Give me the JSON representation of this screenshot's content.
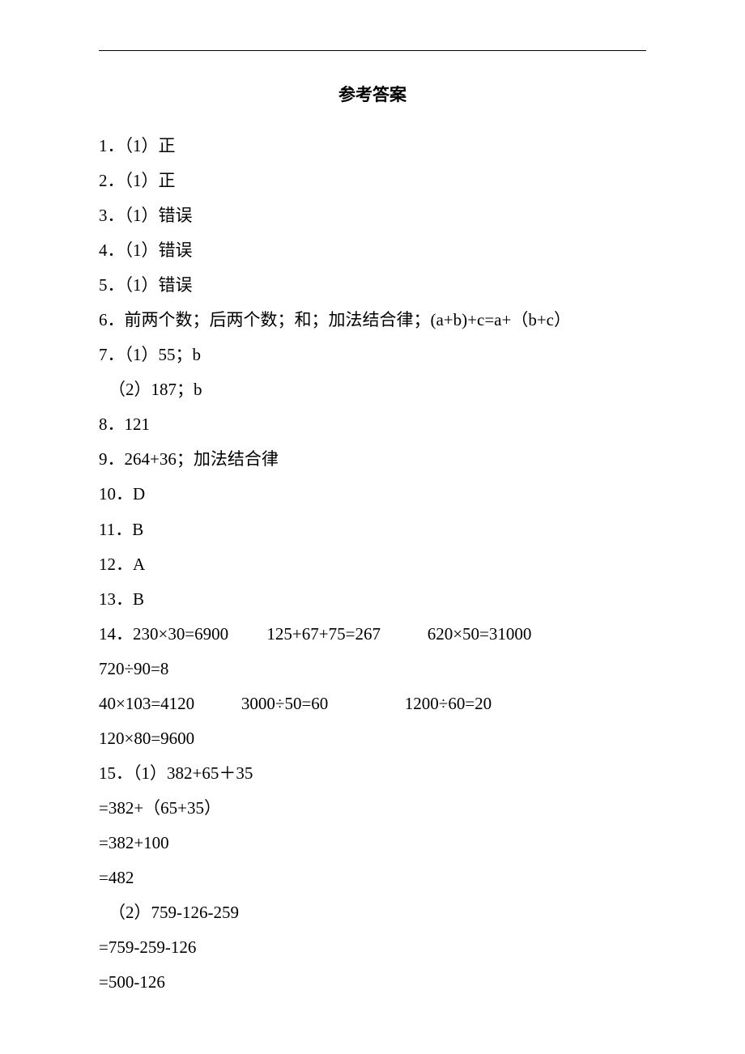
{
  "title": "参考答案",
  "lines": [
    "1．（1）正",
    "2．（1）正",
    "3．（1）错误",
    "4．（1）错误",
    "5．（1）错误",
    "6．前两个数；后两个数；和；加法结合律；(a+b)+c=a+（b+c）",
    "7．（1）55；b",
    "（2）187；b",
    "8．121",
    "9．264+36；加法结合律",
    "10．D",
    "11．B",
    "12．A",
    "13．B",
    "14．230×30=6900         125+67+75=267           620×50=31000",
    "720÷90=8",
    "40×103=4120           3000÷50=60                  1200÷60=20",
    "120×80=9600",
    "15．（1）382+65＋35",
    "=382+（65+35）",
    "=382+100",
    "=482",
    "（2）759-126-259",
    "=759-259-126",
    "=500-126"
  ],
  "indentedIndices": [
    7,
    22
  ]
}
